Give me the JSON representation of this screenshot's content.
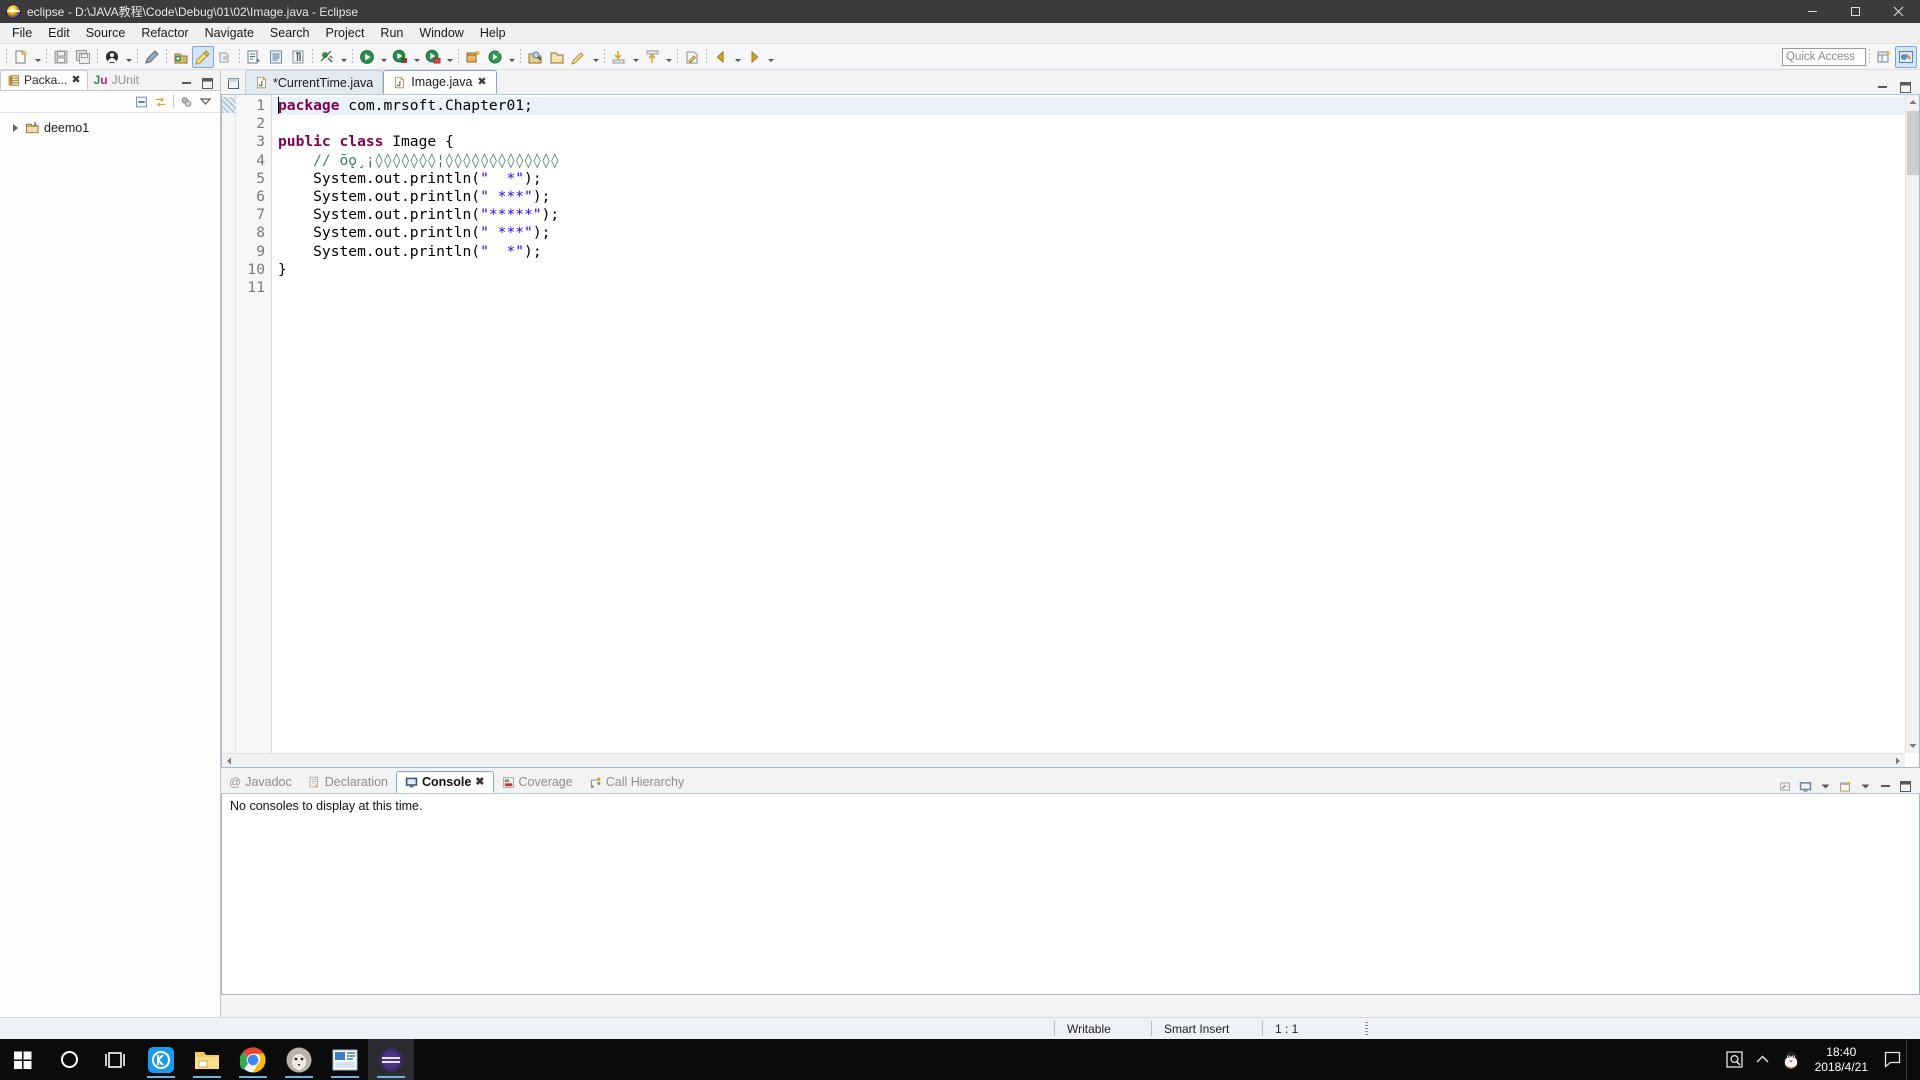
{
  "window": {
    "title": "eclipse - D:\\JAVA教程\\Code\\Debug\\01\\02\\Image.java - Eclipse",
    "icon": "eclipse-icon",
    "minimize_label": "Minimize",
    "maximize_label": "Restore",
    "close_label": "Close"
  },
  "menubar": {
    "items": [
      {
        "label": "File"
      },
      {
        "label": "Edit"
      },
      {
        "label": "Source"
      },
      {
        "label": "Refactor"
      },
      {
        "label": "Navigate"
      },
      {
        "label": "Search"
      },
      {
        "label": "Project"
      },
      {
        "label": "Run"
      },
      {
        "label": "Window"
      },
      {
        "label": "Help"
      }
    ]
  },
  "toolbar": {
    "quick_access_placeholder": "Quick Access",
    "quick_access_value": "",
    "buttons": [
      {
        "name": "new-wizard",
        "tooltip": "New"
      },
      {
        "name": "save",
        "tooltip": "Save"
      },
      {
        "name": "save-all",
        "tooltip": "Save All"
      },
      {
        "name": "print",
        "tooltip": "Print"
      },
      {
        "name": "new-java-package",
        "tooltip": "New Java Package"
      },
      {
        "name": "new-java-class",
        "tooltip": "New Java Class"
      },
      {
        "name": "open-type",
        "tooltip": "Open Type"
      },
      {
        "name": "toggle-mark-occurrences",
        "tooltip": "Toggle Mark Occurrences"
      },
      {
        "name": "build-all",
        "tooltip": "Build All"
      },
      {
        "name": "skip-breakpoints",
        "tooltip": "Skip All Breakpoints"
      },
      {
        "name": "debug",
        "tooltip": "Debug"
      },
      {
        "name": "run",
        "tooltip": "Run"
      },
      {
        "name": "run-coverage",
        "tooltip": "Coverage"
      },
      {
        "name": "new-java-project",
        "tooltip": "New Java Project"
      },
      {
        "name": "external-tools",
        "tooltip": "External Tools"
      },
      {
        "name": "search",
        "tooltip": "Search"
      },
      {
        "name": "open-task",
        "tooltip": "Open Task"
      },
      {
        "name": "pin-editor",
        "tooltip": "Pin Editor"
      },
      {
        "name": "next-annotation",
        "tooltip": "Next Annotation"
      },
      {
        "name": "previous-annotation",
        "tooltip": "Previous Annotation"
      },
      {
        "name": "last-edit-location",
        "tooltip": "Last Edit Location"
      },
      {
        "name": "back",
        "tooltip": "Back"
      },
      {
        "name": "forward",
        "tooltip": "Forward"
      }
    ],
    "perspective_open": "Open Perspective",
    "perspective_java": "Java"
  },
  "left_panel": {
    "tabs": [
      {
        "label": "Packa...",
        "icon": "package-explorer-icon",
        "selected": true,
        "closable": true
      },
      {
        "label": "JUnit",
        "icon": "junit-icon",
        "selected": false,
        "closable": false
      }
    ],
    "controls": [
      {
        "name": "minimize-view-button"
      },
      {
        "name": "maximize-view-button"
      }
    ],
    "view_toolbar": [
      {
        "name": "collapse-all-icon"
      },
      {
        "name": "link-with-editor-icon"
      },
      {
        "name": "view-menu-presentation-icon"
      },
      {
        "name": "view-menu-icon"
      }
    ],
    "tree": [
      {
        "label": "deemo1",
        "icon": "java-project-icon",
        "expanded": false,
        "indent": 0
      }
    ]
  },
  "editor": {
    "tabs": [
      {
        "label": "*CurrentTime.java",
        "icon": "java-file-icon",
        "selected": false,
        "dirty": true
      },
      {
        "label": "Image.java",
        "icon": "java-file-icon",
        "selected": true,
        "dirty": false
      }
    ],
    "controls": [
      {
        "name": "minimize-editor-button"
      },
      {
        "name": "maximize-editor-button"
      }
    ],
    "cursor_line": 1,
    "lines": [
      {
        "n": 1,
        "tokens": [
          {
            "t": "package",
            "c": "kw"
          },
          {
            "t": " com.mrsoft.Chapter01;",
            "c": ""
          }
        ]
      },
      {
        "n": 2,
        "tokens": [
          {
            "t": "",
            "c": ""
          }
        ]
      },
      {
        "n": 3,
        "tokens": [
          {
            "t": "public class",
            "c": "kw"
          },
          {
            "t": " Image {",
            "c": ""
          }
        ]
      },
      {
        "n": 4,
        "tokens": [
          {
            "t": "    // ōǫ¸¡◊◊◊◊◊◊◊¦◊◊◊◊◊◊◊◊◊◊◊◊◊",
            "c": "cmt"
          }
        ]
      },
      {
        "n": 5,
        "tokens": [
          {
            "t": "    System.out.println(",
            "c": ""
          },
          {
            "t": "\"  *\"",
            "c": "str"
          },
          {
            "t": ");",
            "c": ""
          }
        ]
      },
      {
        "n": 6,
        "tokens": [
          {
            "t": "    System.out.println(",
            "c": ""
          },
          {
            "t": "\" ***\"",
            "c": "str"
          },
          {
            "t": ");",
            "c": ""
          }
        ]
      },
      {
        "n": 7,
        "tokens": [
          {
            "t": "    System.out.println(",
            "c": ""
          },
          {
            "t": "\"*****\"",
            "c": "str"
          },
          {
            "t": ");",
            "c": ""
          }
        ]
      },
      {
        "n": 8,
        "tokens": [
          {
            "t": "    System.out.println(",
            "c": ""
          },
          {
            "t": "\" ***\"",
            "c": "str"
          },
          {
            "t": ");",
            "c": ""
          }
        ]
      },
      {
        "n": 9,
        "tokens": [
          {
            "t": "    System.out.println(",
            "c": ""
          },
          {
            "t": "\"  *\"",
            "c": "str"
          },
          {
            "t": ");",
            "c": ""
          }
        ]
      },
      {
        "n": 10,
        "tokens": [
          {
            "t": "}",
            "c": ""
          }
        ]
      },
      {
        "n": 11,
        "tokens": [
          {
            "t": "",
            "c": ""
          }
        ]
      }
    ]
  },
  "console_panel": {
    "tabs": [
      {
        "label": "Javadoc",
        "icon": "javadoc-icon",
        "selected": false,
        "closable": false
      },
      {
        "label": "Declaration",
        "icon": "declaration-icon",
        "selected": false,
        "closable": false
      },
      {
        "label": "Console",
        "icon": "console-icon",
        "selected": true,
        "closable": true
      },
      {
        "label": "Coverage",
        "icon": "coverage-icon",
        "selected": false,
        "closable": false
      },
      {
        "label": "Call Hierarchy",
        "icon": "call-hierarchy-icon",
        "selected": false,
        "closable": false
      }
    ],
    "controls": [
      {
        "name": "clear-console-icon"
      },
      {
        "name": "display-selected-console-icon"
      },
      {
        "name": "open-console-icon"
      },
      {
        "name": "minimize-console-button"
      },
      {
        "name": "maximize-console-button"
      }
    ],
    "message": "No consoles to display at this time."
  },
  "statusbar": {
    "writable": "Writable",
    "insert_mode": "Smart Insert",
    "position": "1 : 1"
  },
  "taskbar": {
    "items": [
      {
        "name": "start-button",
        "label": "Start"
      },
      {
        "name": "cortana-search-button",
        "label": "Search"
      },
      {
        "name": "task-view-button",
        "label": "Task View"
      },
      {
        "name": "taskbar-app-kugou",
        "label": "Kugou",
        "running": true
      },
      {
        "name": "taskbar-app-file-explorer",
        "label": "File Explorer",
        "running": true
      },
      {
        "name": "taskbar-app-chrome",
        "label": "Google Chrome",
        "running": true
      },
      {
        "name": "taskbar-app-photos",
        "label": "Photos",
        "running": true
      },
      {
        "name": "taskbar-app-powerpoint",
        "label": "PowerPoint",
        "running": true
      },
      {
        "name": "taskbar-app-eclipse",
        "label": "Eclipse",
        "running": true,
        "focused": true
      }
    ],
    "tray": [
      {
        "name": "tray-qq-screenshot-icon",
        "label": "Screenshot"
      },
      {
        "name": "tray-show-hidden-icon",
        "label": "Show hidden icons"
      },
      {
        "name": "tray-qq-icon",
        "label": "QQ"
      }
    ],
    "clock_time": "18:40",
    "clock_date": "2018/4/21",
    "action_center_label": "Action Center"
  },
  "colors": {
    "title_bar": "#3b3b3b",
    "keyword": "#7f0055",
    "string": "#2a00ff",
    "comment": "#3f7f5f",
    "tab_selected_border": "#8ba6c4",
    "status_bar": "#eef1f8",
    "taskbar": "#0b0b0c"
  }
}
